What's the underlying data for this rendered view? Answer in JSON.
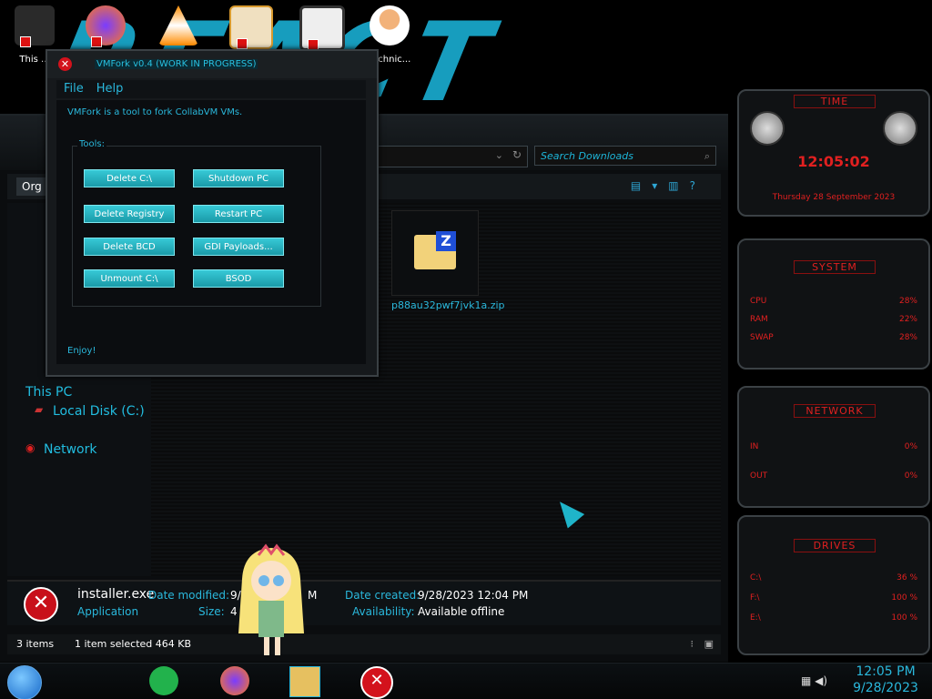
{
  "desktop": {
    "icons": [
      {
        "label": "This ...",
        "color": "#444"
      },
      {
        "label": "",
        "color": "#ff7a1a"
      },
      {
        "label": "",
        "color": "#ff8c00"
      },
      {
        "label": "",
        "color": "#d89a2e"
      },
      {
        "label": "",
        "color": "#888"
      },
      {
        "label": "Technic...",
        "color": "#e89a55"
      }
    ]
  },
  "dialog": {
    "title": "VMFork v0.4 (WORK IN PROGRESS)",
    "menu": [
      "File",
      "Help"
    ],
    "intro": "VMFork is a tool to fork CollabVM VMs.",
    "group_label": "Tools:",
    "buttons": [
      "Delete C:\\",
      "Shutdown PC",
      "Delete Registry",
      "Restart PC",
      "Delete BCD",
      "GDI Payloads...",
      "Unmount C:\\",
      "BSOD"
    ],
    "footer": "Enjoy!"
  },
  "explorer": {
    "search_placeholder": "Search Downloads",
    "organize_label": "Org",
    "nav": [
      "This PC",
      "Local Disk (C:)",
      "Network"
    ],
    "file": {
      "name": "p88au32pwf7jvk1a.zip",
      "icon_letter": "Z"
    },
    "details": {
      "name": "installer.exe",
      "type": "Application",
      "modified_label": "Date modified:",
      "modified_value": "9/",
      "modified_suffix": "M",
      "size_label": "Size:",
      "size_value": "4",
      "created_label": "Date created:",
      "created_value": "9/28/2023 12:04 PM",
      "availability_label": "Availability:",
      "availability_value": "Available offline"
    },
    "status": {
      "items": "3 items",
      "selected": "1 item selected  464 KB"
    }
  },
  "gadgets": {
    "time": {
      "title": "TIME",
      "clock": "12:05:02",
      "date": "Thursday 28 September 2023"
    },
    "system": {
      "title": "SYSTEM",
      "rows": [
        {
          "label": "CPU",
          "value": "28%"
        },
        {
          "label": "RAM",
          "value": "22%"
        },
        {
          "label": "SWAP",
          "value": "28%"
        }
      ]
    },
    "network": {
      "title": "NETWORK",
      "rows": [
        {
          "label": "IN",
          "value": "0%"
        },
        {
          "label": "OUT",
          "value": "0%"
        }
      ]
    },
    "drives": {
      "title": "DRIVES",
      "rows": [
        {
          "label": "C:\\",
          "value": "36 %"
        },
        {
          "label": "F:\\",
          "value": "100 %"
        },
        {
          "label": "E:\\",
          "value": "100 %"
        }
      ]
    }
  },
  "taskbar": {
    "time": "12:05 PM",
    "date": "9/28/2023"
  },
  "colors": {
    "accent": "#2ab8dc",
    "button": "#2fb8c6",
    "alert": "#d3121c",
    "gadget_red": "#e02020"
  }
}
